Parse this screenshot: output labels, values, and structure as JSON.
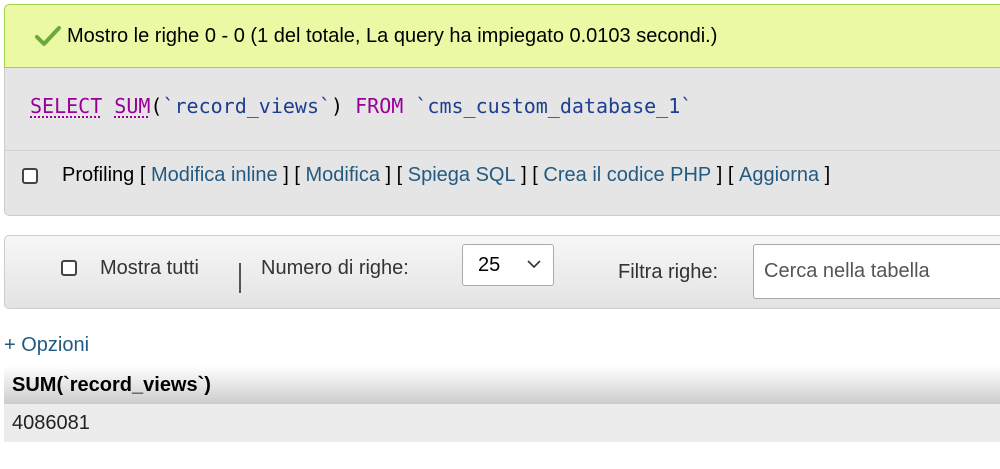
{
  "success": {
    "icon": "check-icon",
    "message": "Mostro le righe 0 - 0 (1 del totale, La query ha impiegato 0.0103 secondi.)",
    "color_bg": "#ebf8a4"
  },
  "sql": {
    "select_kw": "SELECT",
    "sum_fn": "SUM",
    "open": "(",
    "column": "`record_views`",
    "close": ")",
    "from_kw": "FROM",
    "table": "`cms_custom_database_1`"
  },
  "profiling": {
    "label": "Profiling",
    "links": [
      {
        "label": "Modifica inline"
      },
      {
        "label": "Modifica"
      },
      {
        "label": "Spiega SQL"
      },
      {
        "label": "Crea il codice PHP"
      },
      {
        "label": "Aggiorna"
      }
    ]
  },
  "navigation": {
    "show_all_label": "Mostra tutti",
    "rows_label": "Numero di righe:",
    "rows_value": "25",
    "filter_label": "Filtra righe:",
    "search_placeholder": "Cerca nella tabella"
  },
  "options_label": "+ Opzioni",
  "table": {
    "columns": [
      "SUM(`record_views`)"
    ],
    "rows": [
      [
        "4086081"
      ]
    ]
  }
}
